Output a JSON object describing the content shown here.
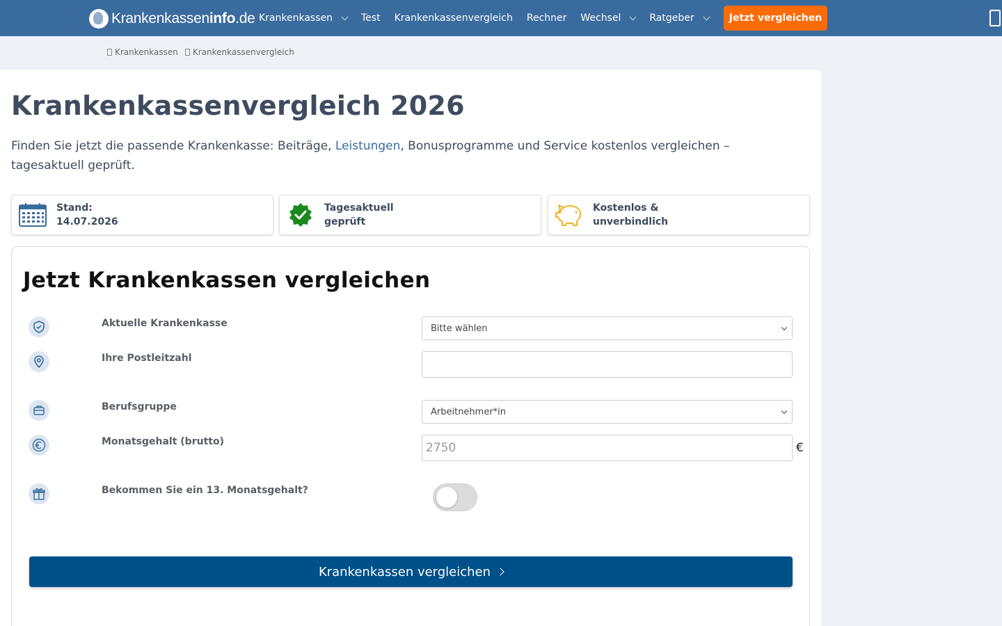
{
  "header": {
    "logo_text_regular": "Krankenkassen",
    "logo_text_bold": "info",
    "logo_text_tld": ".de",
    "nav": [
      {
        "label": "Krankenkassen",
        "dropdown": true
      },
      {
        "label": "Test",
        "dropdown": false
      },
      {
        "label": "Krankenkassenvergleich",
        "dropdown": false
      },
      {
        "label": "Rechner",
        "dropdown": false
      },
      {
        "label": "Wechsel",
        "dropdown": true
      },
      {
        "label": "Ratgeber",
        "dropdown": true
      }
    ],
    "cta_label": "Jetzt vergleichen",
    "colors": {
      "bar": "#3a6b9e",
      "cta": "#fb6c09"
    }
  },
  "breadcrumb": [
    "Krankenkassen",
    "Krankenkassenvergleich"
  ],
  "main": {
    "title": "Krankenkassenvergleich 2026",
    "intro_before": "Finden Sie jetzt die passende Krankenkasse: Beiträge, ",
    "intro_link": "Leistungen",
    "intro_after": ", Bonusprogramme und Service kostenlos vergleichen – tagesaktuell geprüft.",
    "info_boxes": [
      {
        "icon": "calendar-icon",
        "line1": "Stand:",
        "line2": "14.07.2026"
      },
      {
        "icon": "verified-check-icon",
        "line1": "Tagesaktuell",
        "line2": "geprüft"
      },
      {
        "icon": "piggy-bank-icon",
        "line1": "Kostenlos &",
        "line2": "unverbindlich"
      }
    ]
  },
  "form": {
    "title": "Jetzt Krankenkassen vergleichen",
    "current_insurer": {
      "icon": "shield-icon",
      "label": "Aktuelle Krankenkasse",
      "value": "Bitte wählen"
    },
    "postcode": {
      "icon": "location-pin-icon",
      "label": "Ihre Postleitzahl",
      "value": ""
    },
    "occupation": {
      "icon": "briefcase-icon",
      "label": "Berufsgruppe",
      "value": "Arbeitnehmer*in"
    },
    "salary": {
      "icon": "euro-icon",
      "label": "Monatsgehalt (brutto)",
      "placeholder": "2750",
      "unit": "€"
    },
    "thirteenth_salary": {
      "icon": "gift-icon",
      "label": "Bekommen Sie ein 13. Monatsgehalt?",
      "enabled": false
    },
    "submit_label": "Krankenkassen vergleichen",
    "colors": {
      "submit": "#005089",
      "icon_circle": "#dce6f1"
    }
  }
}
